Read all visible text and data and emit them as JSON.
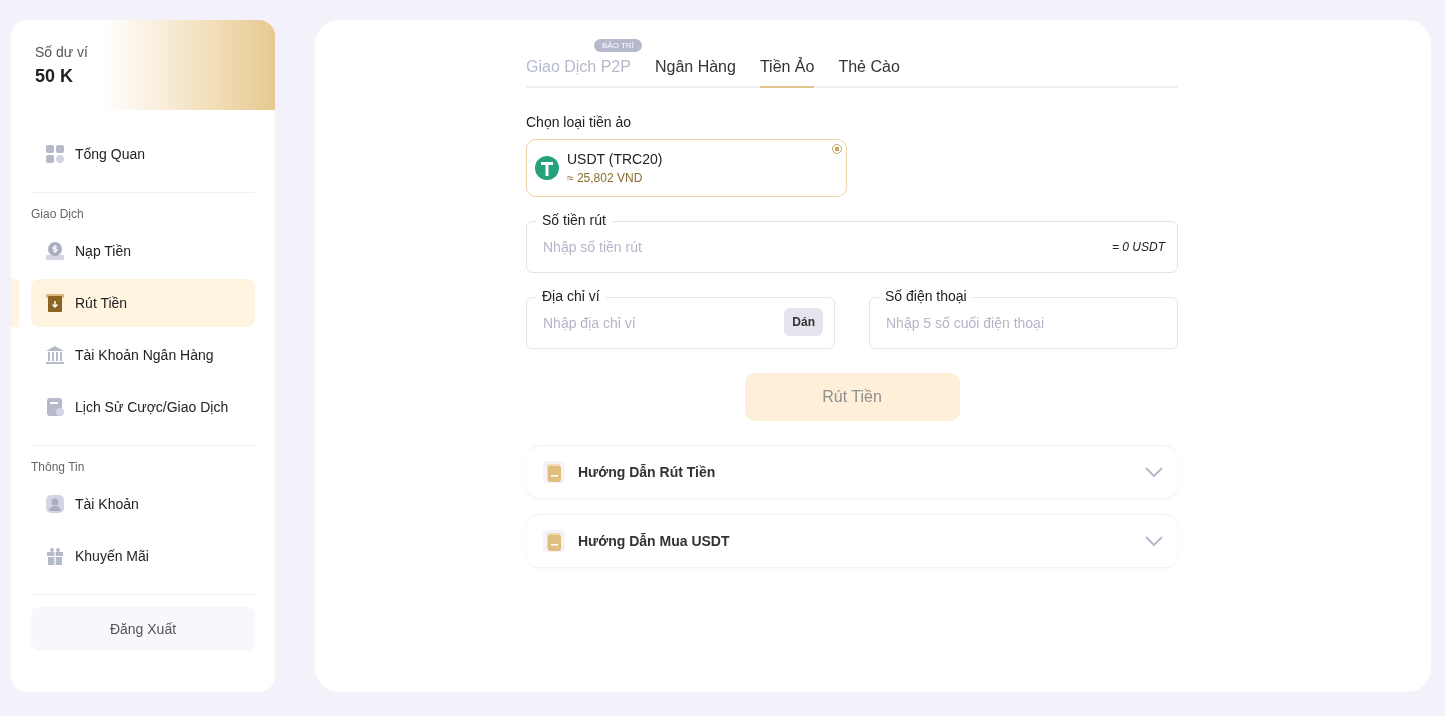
{
  "wallet": {
    "label": "Số dư ví",
    "balance": "50 K"
  },
  "sidebar": {
    "sections": [
      {
        "items": [
          {
            "label": "Tổng Quan",
            "selected": false
          }
        ]
      },
      {
        "heading": "Giao Dịch",
        "items": [
          {
            "label": "Nạp Tiền",
            "selected": false
          },
          {
            "label": "Rút Tiền",
            "selected": true
          },
          {
            "label": "Tài Khoản Ngân Hàng",
            "selected": false
          },
          {
            "label": "Lịch Sử Cược/Giao Dịch",
            "selected": false
          }
        ]
      },
      {
        "heading": "Thông Tin",
        "items": [
          {
            "label": "Tài Khoản",
            "selected": false
          },
          {
            "label": "Khuyến Mãi",
            "selected": false
          }
        ]
      }
    ],
    "logout": "Đăng Xuất"
  },
  "tabs": [
    {
      "label": "Giao Dịch P2P",
      "selected": false,
      "disabled": true,
      "badge": "BẢO TRÌ"
    },
    {
      "label": "Ngân Hàng",
      "selected": false,
      "disabled": false
    },
    {
      "label": "Tiền Ảo",
      "selected": true,
      "disabled": false
    },
    {
      "label": "Thẻ Cào",
      "selected": false,
      "disabled": false
    }
  ],
  "coin_select": {
    "label": "Chọn loại tiền ảo",
    "options": [
      {
        "name": "USDT (TRC20)",
        "rate": "≈ 25,802 VND",
        "selected": true
      }
    ]
  },
  "amount_field": {
    "label": "Số tiền rút",
    "placeholder": "Nhập số tiền rút",
    "conversion": "= 0 USDT"
  },
  "address_field": {
    "label": "Địa chỉ ví",
    "placeholder": "Nhập địa chỉ ví",
    "paste": "Dán"
  },
  "phone_field": {
    "label": "Số điện thoại",
    "placeholder": "Nhập 5 số cuối điện thoại"
  },
  "submit": {
    "label": "Rút Tiền",
    "disabled": true
  },
  "guides": [
    {
      "title": "Hướng Dẫn Rút Tiền",
      "expanded": false
    },
    {
      "title": "Hướng Dẫn Mua USDT",
      "expanded": false
    }
  ]
}
